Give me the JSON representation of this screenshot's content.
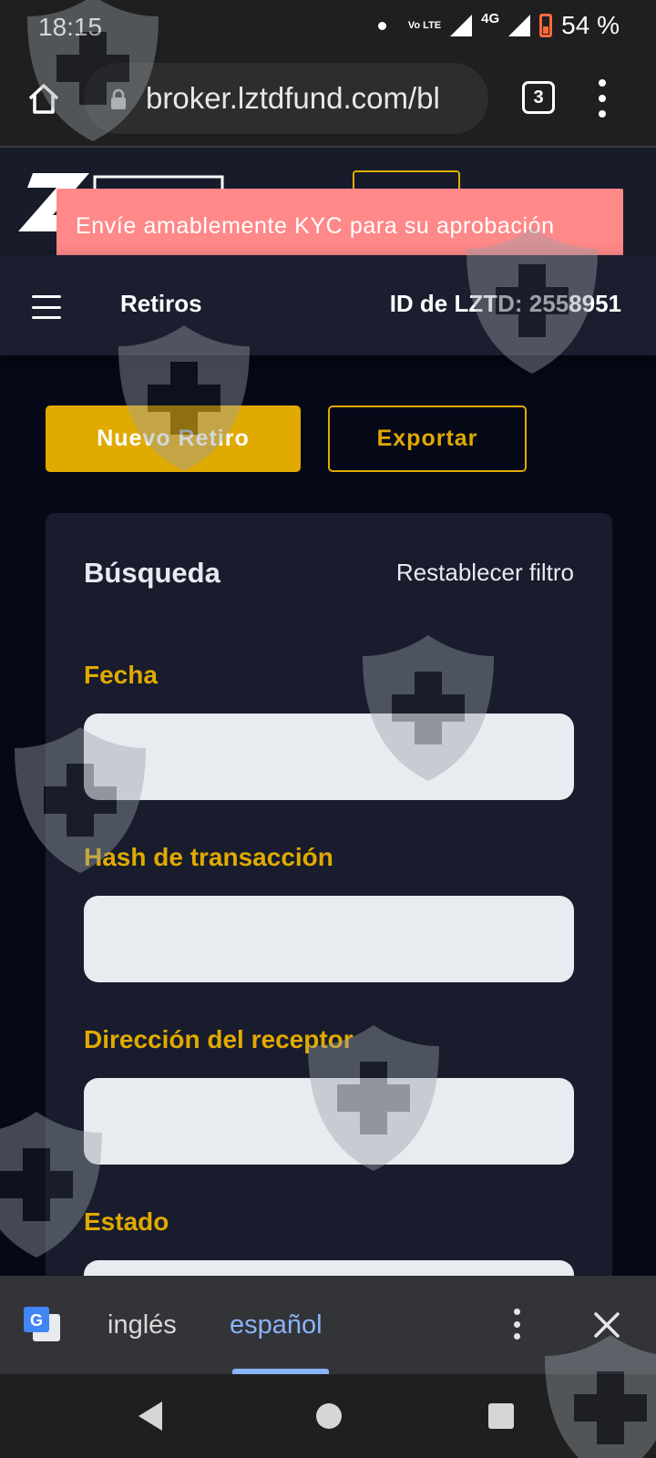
{
  "status_bar": {
    "time": "18:15",
    "network": "4G",
    "volte": "Vo LTE",
    "battery": "54 %"
  },
  "browser": {
    "url": "broker.lztdfund.com/bl",
    "tab_count": "3"
  },
  "toast": {
    "message": "Envíe amablemente KYC para su aprobación"
  },
  "header": {
    "page_title": "Retiros",
    "account_id": "ID de LZTD: 2558951"
  },
  "actions": {
    "new_withdrawal": "Nuevo Retiro",
    "export": "Exportar"
  },
  "search": {
    "title": "Búsqueda",
    "reset": "Restablecer filtro",
    "fields": [
      {
        "label": "Fecha",
        "value": ""
      },
      {
        "label": "Hash de transacción",
        "value": ""
      },
      {
        "label": "Dirección del receptor",
        "value": ""
      },
      {
        "label": "Estado",
        "value": ""
      }
    ]
  },
  "translate_bar": {
    "source_lang": "inglés",
    "target_lang": "español"
  },
  "colors": {
    "accent": "#e1aa00",
    "toast": "#ff8888",
    "background": "#050816",
    "card": "#181c2c",
    "link_blue": "#8ab4f8"
  },
  "icons": [
    "home-icon",
    "lock-icon",
    "tabs-icon",
    "more-vert-icon",
    "menu-icon",
    "google-translate-icon",
    "close-icon",
    "shield-watermark-icon",
    "nav-back-icon",
    "nav-home-icon",
    "nav-recents-icon"
  ]
}
